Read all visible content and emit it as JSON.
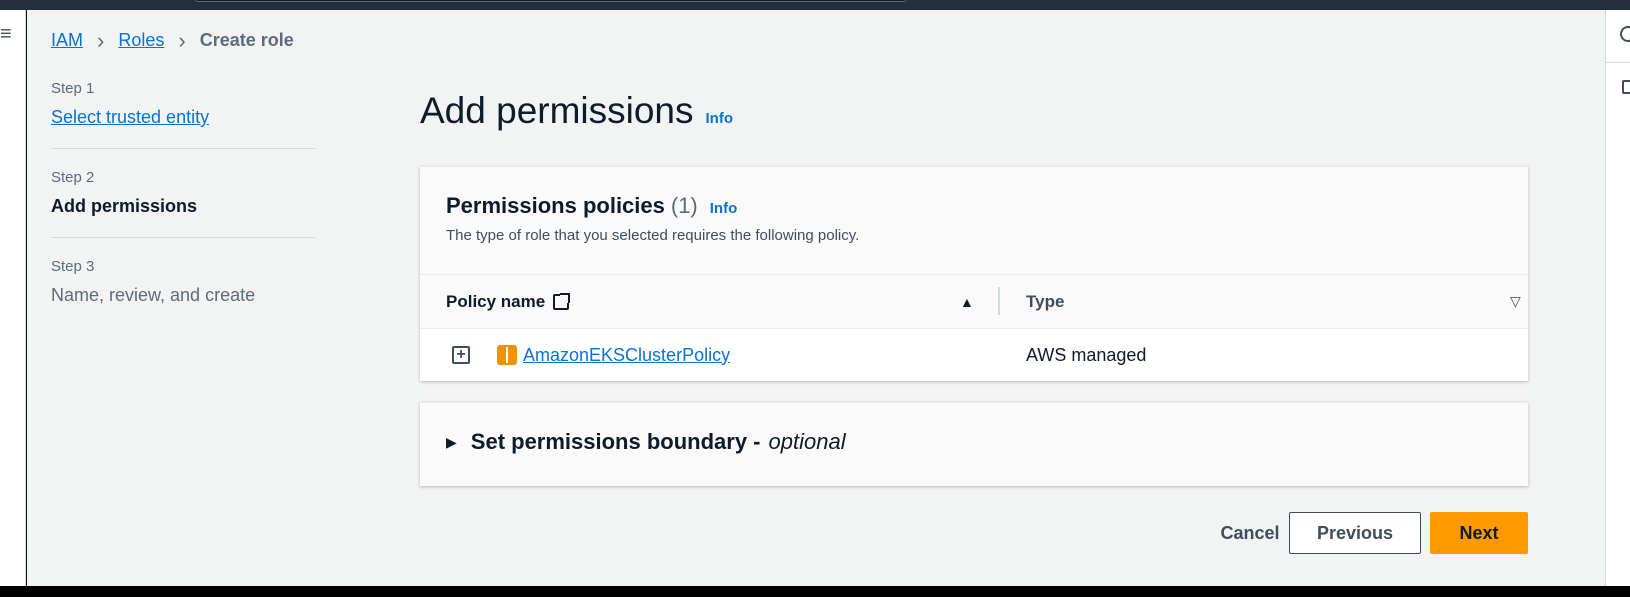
{
  "breadcrumb": {
    "items": [
      "IAM",
      "Roles",
      "Create role"
    ]
  },
  "steps": [
    {
      "num": "Step 1",
      "label": "Select trusted entity",
      "state": "link"
    },
    {
      "num": "Step 2",
      "label": "Add permissions",
      "state": "active"
    },
    {
      "num": "Step 3",
      "label": "Name, review, and create",
      "state": "disabled"
    }
  ],
  "header": {
    "title": "Add permissions",
    "info": "Info"
  },
  "policies_panel": {
    "title": "Permissions policies",
    "count": "(1)",
    "info": "Info",
    "description": "The type of role that you selected requires the following policy.",
    "columns": {
      "name": "Policy name",
      "type": "Type"
    },
    "rows": [
      {
        "name": "AmazonEKSClusterPolicy",
        "type": "AWS managed"
      }
    ]
  },
  "boundary_panel": {
    "title": "Set permissions boundary -",
    "optional": "optional"
  },
  "actions": {
    "cancel": "Cancel",
    "previous": "Previous",
    "next": "Next"
  },
  "colors": {
    "link": "#0972d3",
    "primary_button": "#ff9900",
    "background": "#f2f3f3",
    "nav": "#232f3e"
  }
}
